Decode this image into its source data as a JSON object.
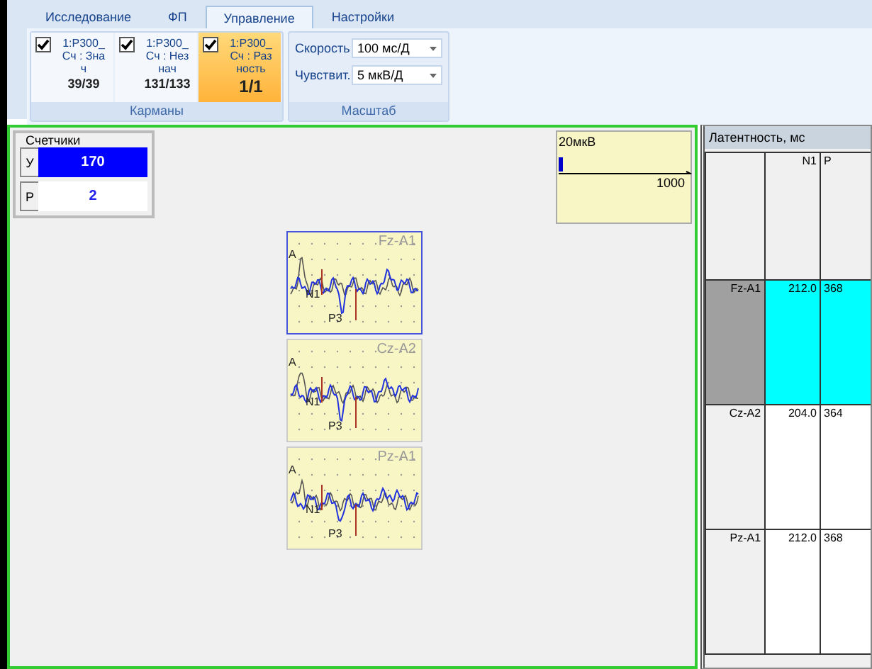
{
  "ribbon": {
    "tabs": [
      {
        "label": "Исследование",
        "selected": false
      },
      {
        "label": "ФП",
        "selected": false
      },
      {
        "label": "Управление",
        "selected": true
      },
      {
        "label": "Настройки",
        "selected": false
      }
    ],
    "groups": [
      {
        "kind": "pockets",
        "title": "Карманы",
        "pockets": [
          {
            "label": "1:P300_Сч : Знач",
            "count": "39/39",
            "checked": true,
            "selected": false
          },
          {
            "label": "1:P300_Сч : Незнач",
            "count": "131/133",
            "checked": true,
            "selected": false
          },
          {
            "label": "1:P300_Сч : Разность",
            "count": "1/1",
            "checked": true,
            "selected": true
          }
        ]
      },
      {
        "kind": "scale",
        "title": "Масштаб",
        "combos": [
          {
            "label": "Скорость",
            "value": "100 мс/Д"
          },
          {
            "label": "Чувствит.",
            "value": "5 мкВ/Д"
          }
        ]
      }
    ]
  },
  "counters": {
    "title": "Счетчики",
    "rows": [
      {
        "label": "У",
        "value": "170",
        "selected": true
      },
      {
        "label": "Р",
        "value": "2",
        "selected": false
      }
    ]
  },
  "amplitude": {
    "label": "20мкВ",
    "axis_end": "1000"
  },
  "waveforms": [
    {
      "channel": "Fz-A1",
      "selected": true,
      "marks": [
        "A",
        "N1",
        "P3"
      ]
    },
    {
      "channel": "Cz-A2",
      "selected": false,
      "marks": [
        "A",
        "N1",
        "P3"
      ]
    },
    {
      "channel": "Pz-A1",
      "selected": false,
      "marks": [
        "A",
        "N1",
        "P3"
      ]
    }
  ],
  "latency": {
    "title": "Латентность, мс",
    "columns": [
      "N1",
      "P"
    ],
    "rows": [
      {
        "label": "Fz-A1",
        "cells": [
          "212.0",
          "368"
        ],
        "selected": true
      },
      {
        "label": "Cz-A2",
        "cells": [
          "204.0",
          "364"
        ],
        "selected": false
      },
      {
        "label": "Pz-A1",
        "cells": [
          "212.0",
          "368"
        ],
        "selected": false
      }
    ]
  }
}
